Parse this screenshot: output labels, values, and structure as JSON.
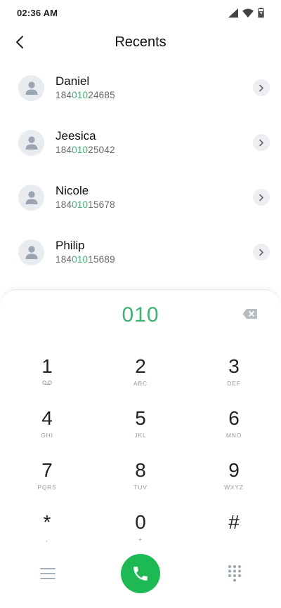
{
  "status_bar": {
    "time": "02:36 AM",
    "icons": [
      "signal-icon",
      "wifi-icon",
      "battery-icon"
    ]
  },
  "header": {
    "title": "Recents",
    "back_icon": "chevron-left-icon"
  },
  "contacts": [
    {
      "name": "Daniel",
      "number_prefix": "184",
      "number_match": "010",
      "number_suffix": "24685"
    },
    {
      "name": "Jeesica",
      "number_prefix": "184",
      "number_match": "010",
      "number_suffix": "25042"
    },
    {
      "name": "Nicole",
      "number_prefix": "184",
      "number_match": "010",
      "number_suffix": "15678"
    },
    {
      "name": "Philip",
      "number_prefix": "184",
      "number_match": "010",
      "number_suffix": "15689"
    }
  ],
  "dialpad": {
    "display": "010",
    "keys": [
      {
        "digit": "1",
        "letters": ""
      },
      {
        "digit": "2",
        "letters": "ABC"
      },
      {
        "digit": "3",
        "letters": "DEF"
      },
      {
        "digit": "4",
        "letters": "GHI"
      },
      {
        "digit": "5",
        "letters": "JKL"
      },
      {
        "digit": "6",
        "letters": "MNO"
      },
      {
        "digit": "7",
        "letters": "PQRS"
      },
      {
        "digit": "8",
        "letters": "TUV"
      },
      {
        "digit": "9",
        "letters": "WXYZ"
      },
      {
        "digit": "*",
        "letters": ","
      },
      {
        "digit": "0",
        "letters": "+"
      },
      {
        "digit": "#",
        "letters": ""
      }
    ]
  },
  "colors": {
    "accent": "#3cb371",
    "call": "#1db954",
    "avatar_bg": "#e8ebef",
    "icon_gray": "#9aa5b1"
  }
}
